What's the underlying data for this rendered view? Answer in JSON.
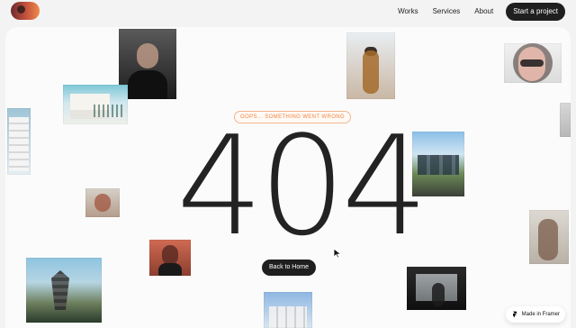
{
  "header": {
    "logo_icon": "avatar-logo-icon",
    "nav": {
      "items": [
        {
          "label": "Works"
        },
        {
          "label": "Services"
        },
        {
          "label": "About"
        }
      ],
      "cta_label": "Start a project"
    }
  },
  "error_page": {
    "badge_text": "OOPS... SOMETHING WENT WRONG",
    "code": "404",
    "button_label": "Back to Home"
  },
  "framer_badge": {
    "label": "Made in Framer",
    "icon": "framer-icon"
  },
  "colors": {
    "background": "#f3f3f3",
    "card": "#fbfbfb",
    "accent": "#f0863f",
    "dark": "#1f1f1f"
  }
}
